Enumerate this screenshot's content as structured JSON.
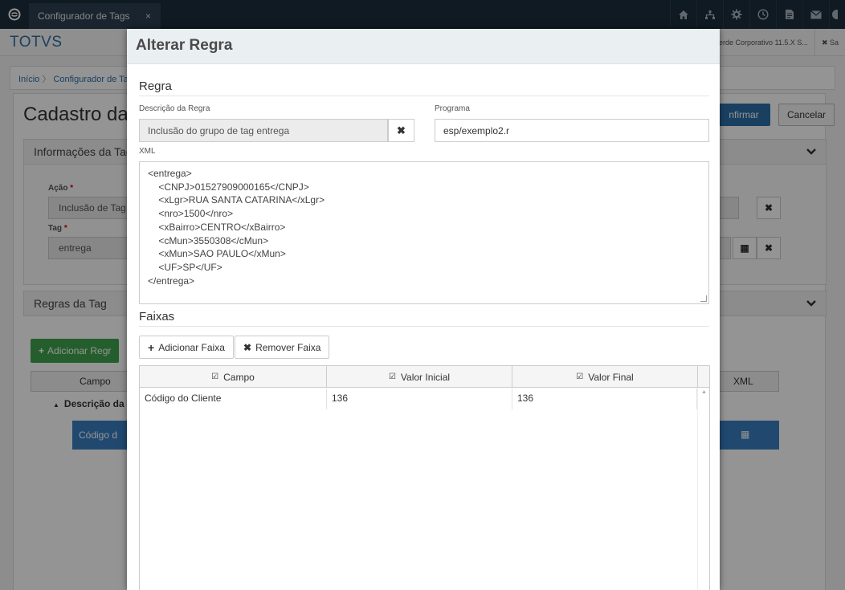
{
  "topbar": {
    "tab_label": "Configurador de Tags",
    "tab_close": "×",
    "icons": [
      "home-icon",
      "sitemap-icon",
      "gear-icon",
      "clock-icon",
      "document-icon",
      "mail-icon",
      "circle-icon"
    ]
  },
  "background": {
    "brand": "TOTVS",
    "right_tab_1": "erde Corporativo 11.5.X S...",
    "right_tab_2": "✖ Sa",
    "breadcrumb": {
      "home": "Início",
      "separator": "〉",
      "current": "Configurador de Ta"
    },
    "title": "Cadastro da",
    "confirm_label": "nfirmar",
    "cancel_label": "Cancelar",
    "section_info": "Informações da Tag",
    "acao_label": "Ação",
    "acao_value": "Inclusão de Tag",
    "tag_label": "Tag",
    "tag_value": "entrega",
    "section_rules": "Regras da Tag",
    "add_rule_label": "Adicionar Regr",
    "grid_col_campo": "Campo",
    "grid_col_xml": "XML",
    "group_row": "Descrição da R",
    "blue_row": "Código d",
    "required_mark": "*"
  },
  "modal": {
    "title": "Alterar Regra",
    "section_regra": "Regra",
    "descricao_label": "Descrição da Regra",
    "descricao_value": "Inclusão do grupo de tag entrega",
    "programa_label": "Programa",
    "programa_value": "esp/exemplo2.r",
    "xml_label": "XML",
    "xml_lines": [
      "<entrega>",
      "    <CNPJ>01527909000165</CNPJ>",
      "    <xLgr>RUA SANTA CATARINA</xLgr>",
      "    <nro>1500</nro>",
      "    <xBairro>CENTRO</xBairro>",
      "    <cMun>3550308</cMun>",
      "    <xMun>SAO PAULO</xMun>",
      "    <UF>SP</UF>",
      "</entrega>"
    ],
    "section_faixas": "Faixas",
    "add_faixa_label": "Adicionar Faixa",
    "remove_faixa_label": "Remover Faixa",
    "grid_headers": [
      "Campo",
      "Valor Inicial",
      "Valor Final"
    ],
    "grid_rows": [
      {
        "campo": "Código do Cliente",
        "valor_inicial": "136",
        "valor_final": "136"
      }
    ]
  },
  "colors": {
    "topbar": "#1d2d3b",
    "brand": "#2d6fa8",
    "primary_button": "#2d6fa8",
    "add_button": "#3fa34d",
    "selected_row": "#3a7fc1"
  }
}
